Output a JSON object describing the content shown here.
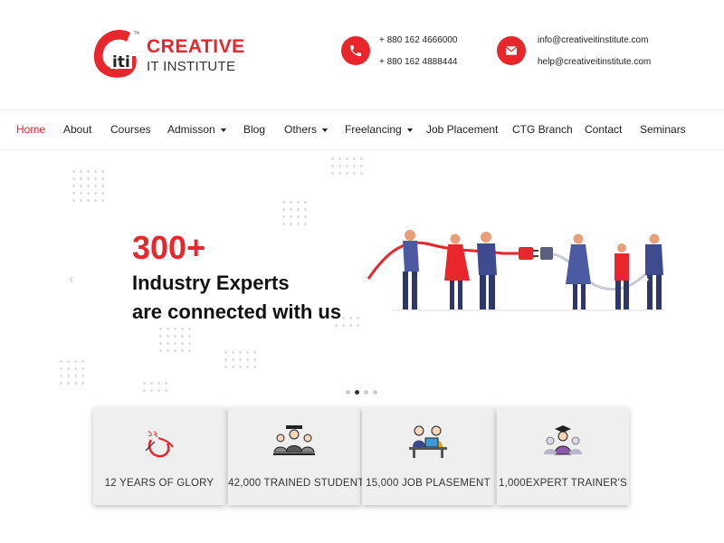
{
  "brand": {
    "name_line1": "CREATIVE",
    "name_line2": "IT INSTITUTE",
    "logo_letters": "iti",
    "primary_color": "#e8262b"
  },
  "contact": {
    "phones": [
      "+ 880 162 4666000",
      "+ 880 162 4888444"
    ],
    "emails": [
      "info@creativeitinstitute.com",
      "help@creativeitinstitute.com"
    ],
    "phone_icon": "phone-icon",
    "email_icon": "envelope-icon"
  },
  "nav": {
    "items": [
      {
        "label": "Home",
        "active": true,
        "dropdown": false
      },
      {
        "label": "About",
        "active": false,
        "dropdown": false
      },
      {
        "label": "Courses",
        "active": false,
        "dropdown": false
      },
      {
        "label": "Admisson",
        "active": false,
        "dropdown": true
      },
      {
        "label": "Blog",
        "active": false,
        "dropdown": false
      },
      {
        "label": "Others",
        "active": false,
        "dropdown": true
      },
      {
        "label": "Freelancing",
        "active": false,
        "dropdown": true
      },
      {
        "label": "Job Placement",
        "active": false,
        "dropdown": false
      },
      {
        "label": "CTG Branch",
        "active": false,
        "dropdown": false
      },
      {
        "label": "Contact",
        "active": false,
        "dropdown": false
      },
      {
        "label": "Seminars",
        "active": false,
        "dropdown": false
      }
    ]
  },
  "hero": {
    "big_number": "300+",
    "line1": "Industry Experts",
    "line2": "are connected with us",
    "prev_arrow": "‹",
    "next_arrow": "›",
    "slides_count": 4,
    "active_slide": 2
  },
  "stats": [
    {
      "label": "12 YEARS OF GLORY",
      "icon": "glory-badge-icon"
    },
    {
      "label": "42,000 TRAINED STUDENT",
      "icon": "graduates-icon"
    },
    {
      "label": "15,000 JOB PLASEMENT",
      "icon": "office-workers-icon"
    },
    {
      "label": "1,000EXPERT TRAINER'S",
      "icon": "trainer-graduate-icon"
    }
  ]
}
